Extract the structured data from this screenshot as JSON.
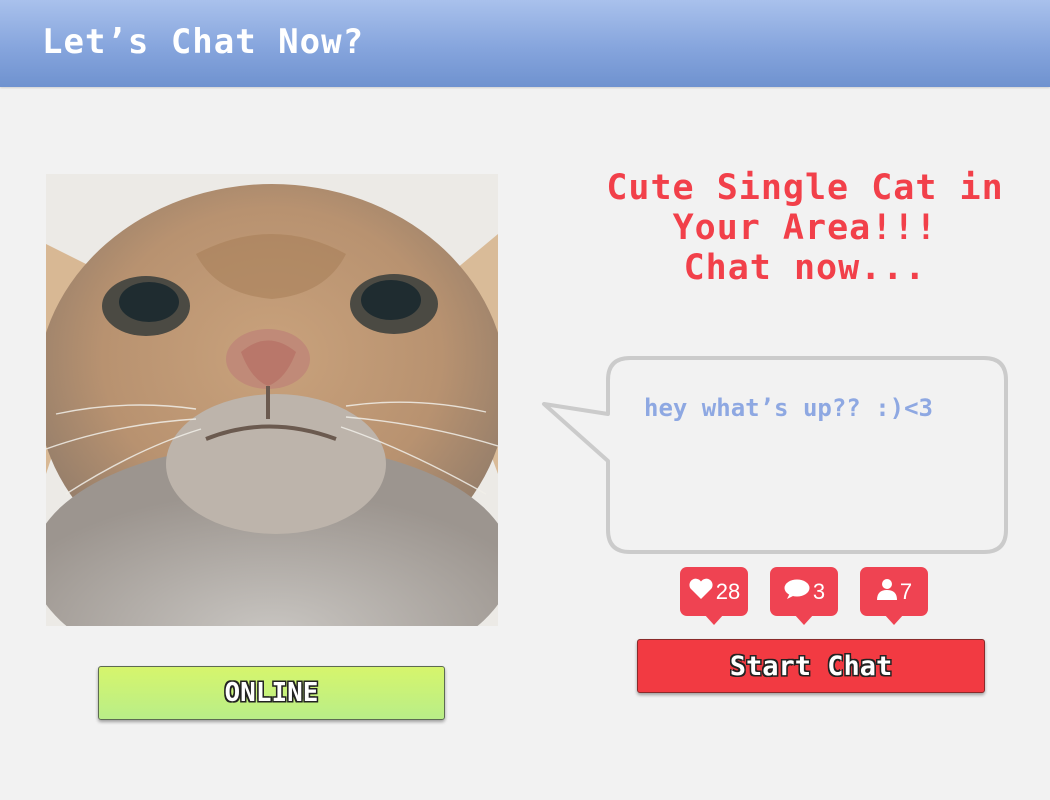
{
  "header": {
    "title": "Let’s Chat Now?"
  },
  "profile": {
    "photo_icon": "cat-photo",
    "status_label": "ONLINE"
  },
  "headline": {
    "lines": [
      "Cute Single Cat in",
      "Your Area!!!",
      "Chat now..."
    ]
  },
  "bubble": {
    "message": "hey what’s up?? :)<3"
  },
  "stats": {
    "likes": {
      "icon": "heart-icon",
      "count": "28"
    },
    "comments": {
      "icon": "speech-bubble-icon",
      "count": "3"
    },
    "followers": {
      "icon": "person-icon",
      "count": "7"
    }
  },
  "actions": {
    "start_label": "Start Chat"
  },
  "colors": {
    "header": "#86a5dd",
    "accent_red": "#f2404a",
    "online_green": "#c6f27a",
    "bubble_text": "#8ea8e2"
  }
}
